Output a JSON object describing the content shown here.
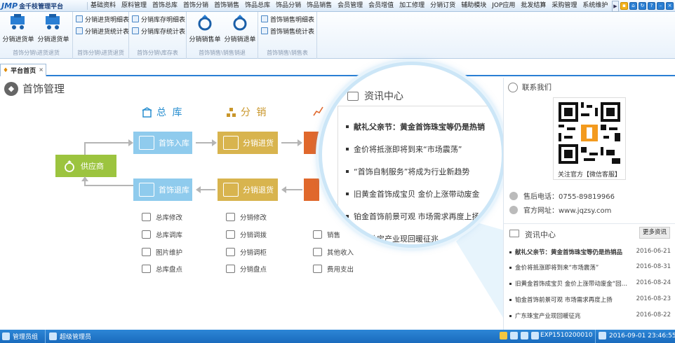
{
  "app": {
    "logo_mark": "JMP",
    "logo_text": "金千枝管理平台"
  },
  "menu": [
    "基础资料",
    "原料管理",
    "首饰总库",
    "首饰分销",
    "首饰销售",
    "饰品总库",
    "饰品分销",
    "饰品销售",
    "会员管理",
    "会员增值",
    "加工修理",
    "分销订货",
    "辅助模块",
    "JOP应用",
    "批发结算",
    "采购管理",
    "系统维护"
  ],
  "ribbon": {
    "groups": [
      {
        "title": "首饰分销\\进货退货",
        "big": [
          "分销进货单",
          "分销退货单"
        ]
      },
      {
        "title": "首饰分销\\进货退货",
        "small": [
          "分销进货明细表",
          "分销进货统计表"
        ]
      },
      {
        "title": "首饰分销\\库存表",
        "small": [
          "分销库存明细表",
          "分销库存统计表"
        ]
      },
      {
        "title": "首饰销售\\销售销退",
        "big": [
          "分销销售单",
          "分销销退单"
        ]
      },
      {
        "title": "首饰销售\\销售表",
        "small": [
          "首饰销售明细表",
          "首饰销售统计表"
        ]
      }
    ]
  },
  "tabs": [
    {
      "label": "平台首页",
      "close": "×"
    }
  ],
  "main": {
    "title": "首饰管理",
    "col_heads": [
      "总 库",
      "分 销"
    ],
    "supplier": "供应商",
    "flow": {
      "in": "首饰入库",
      "out": "首饰退库",
      "dist_in": "分销进货",
      "dist_out": "分销退货"
    },
    "zongku_items": [
      "总库修改",
      "总库调库",
      "图片维护",
      "总库盘点"
    ],
    "fenxiao_items": [
      "分销修改",
      "分销调拨",
      "分销调柜",
      "分销盘点"
    ],
    "third_items": [
      "销售",
      "其他收入",
      "费用支出"
    ]
  },
  "lens": {
    "title": "资讯中心",
    "items": [
      "献礼父亲节：黄金首饰珠宝等仍是热销",
      "金价将抵涨即将到来“市场震荡”",
      "“首饰自制服务”将成为行业新趋势",
      "旧黄金首饰成宝贝 金价上涨带动废金",
      "铂金首饰前景可观 市场需求再度上扬",
      "广东珠宝产业现回暖征兆"
    ]
  },
  "contact": {
    "title": "联系我们",
    "qr_label": "关注官方【微信客服】",
    "phone": "售后电话：0755-89819966",
    "site": "官方网址：www.jqzsy.com"
  },
  "news": {
    "title": "资讯中心",
    "more": "更多资讯",
    "items": [
      {
        "t": "献礼父亲节：黄金首饰珠宝等仍是热销品",
        "d": "2016-06-21",
        "b": true
      },
      {
        "t": "金价将抵涨即将到来“市场震荡”",
        "d": "2016-08-31",
        "b": false
      },
      {
        "t": "旧黄金首饰成宝贝 金价上涨带动废金“回…",
        "d": "2016-08-24",
        "b": false
      },
      {
        "t": "铂金首饰前景可观 市场需求再度上扬",
        "d": "2016-08-23",
        "b": false
      },
      {
        "t": "广东珠宝产业现回暖征兆",
        "d": "2016-08-22",
        "b": false
      }
    ]
  },
  "status": {
    "group": "管理员组",
    "user": "超级管理员",
    "code": "EXP1510200010",
    "datetime": "2016-09-01 23:46:55"
  },
  "colors": {
    "accent": "#2a7fd4",
    "blue": "#8fcbed",
    "gold": "#d8b44e",
    "orange": "#e0682c",
    "green": "#9cc43f"
  }
}
